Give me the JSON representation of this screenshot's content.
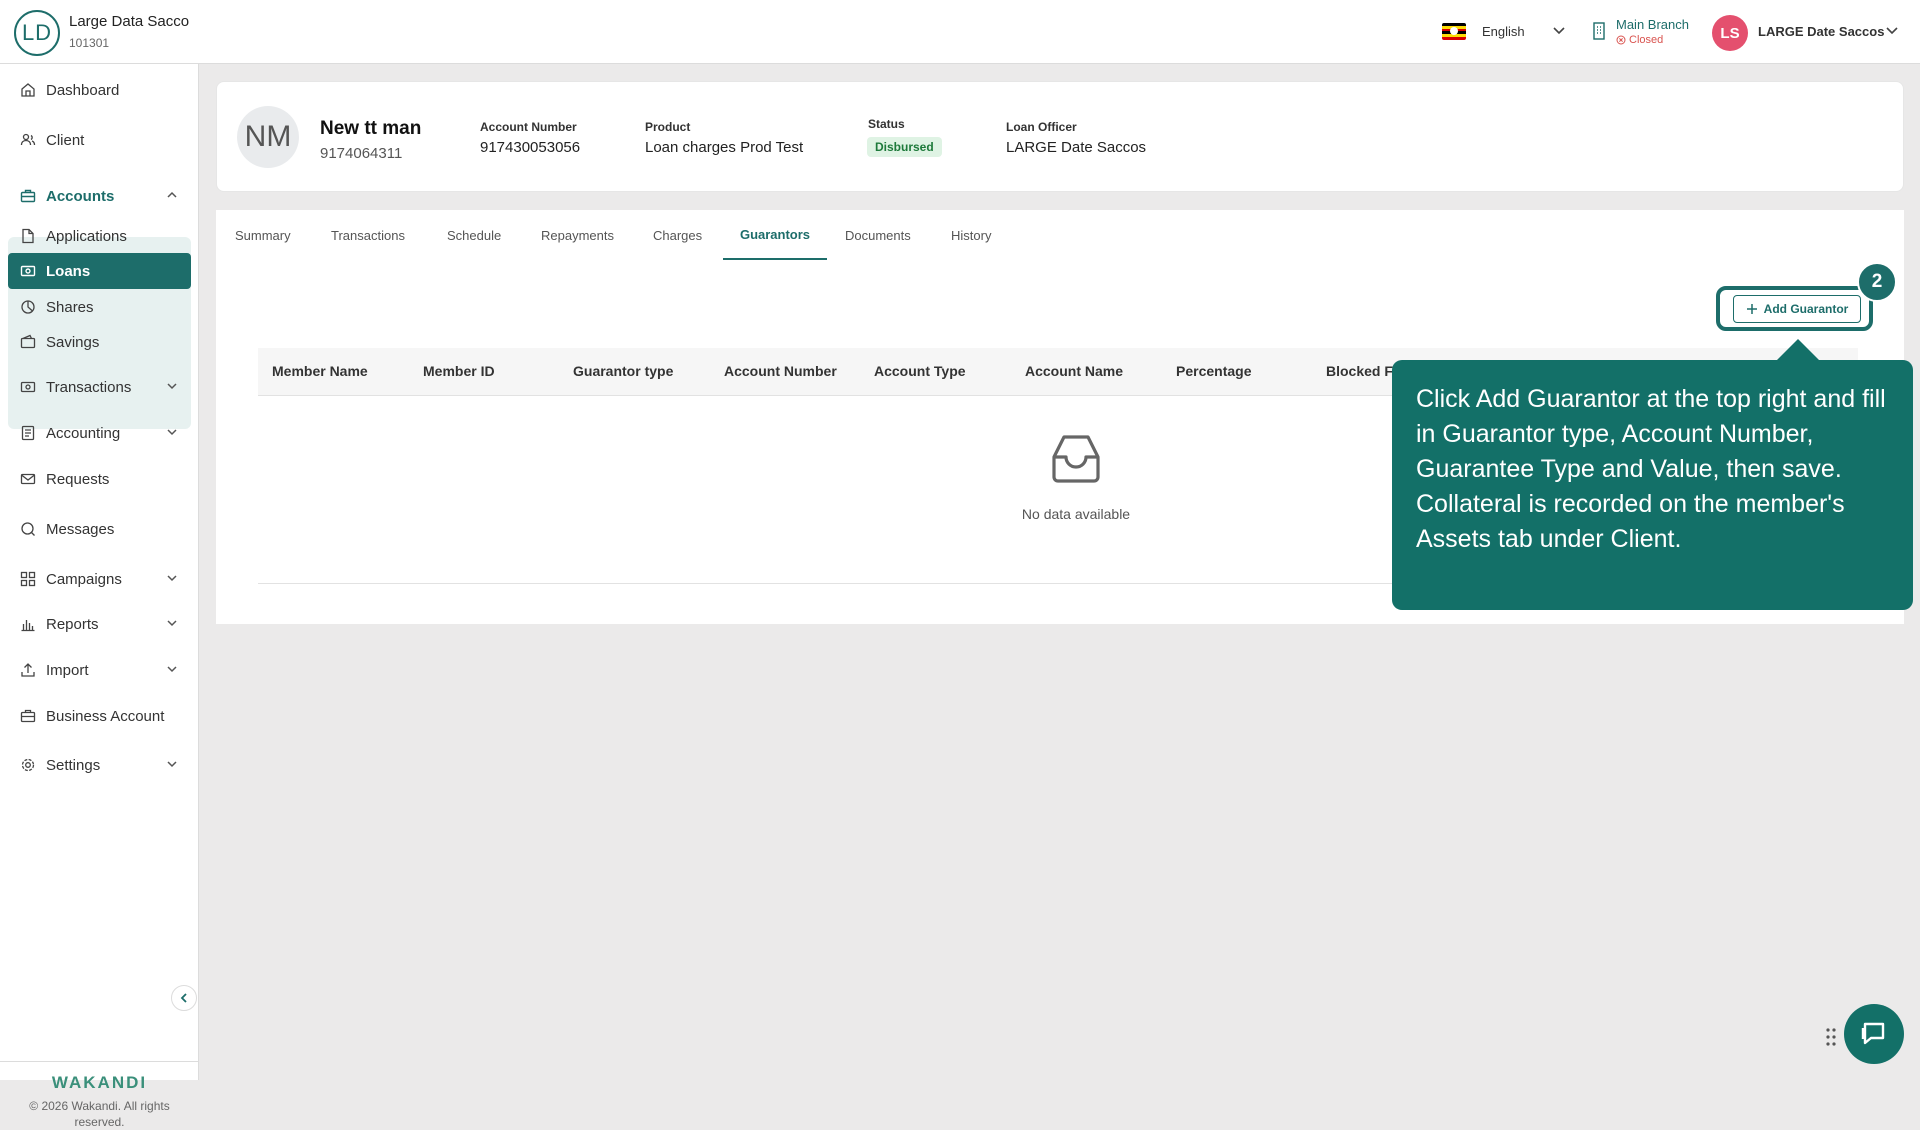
{
  "topbar": {
    "org_initials": "LD",
    "org_name": "Large Data Sacco",
    "org_id": "101301",
    "language": "English",
    "branch_name": "Main Branch",
    "branch_status": "Closed",
    "user_initials": "LS",
    "user_name": "LARGE Date Saccos"
  },
  "sidebar": {
    "items": [
      {
        "label": "Dashboard",
        "icon": "home-icon"
      },
      {
        "label": "Client",
        "icon": "users-icon"
      },
      {
        "label": "Accounts",
        "icon": "briefcase-icon"
      },
      {
        "label": "Applications",
        "icon": "file-icon"
      },
      {
        "label": "Loans",
        "icon": "cash-icon"
      },
      {
        "label": "Shares",
        "icon": "pie-icon"
      },
      {
        "label": "Savings",
        "icon": "wallet-icon"
      },
      {
        "label": "Transactions",
        "icon": "cash-icon"
      },
      {
        "label": "Accounting",
        "icon": "ledger-icon"
      },
      {
        "label": "Requests",
        "icon": "mail-icon"
      },
      {
        "label": "Messages",
        "icon": "chat-icon"
      },
      {
        "label": "Campaigns",
        "icon": "grid-icon"
      },
      {
        "label": "Reports",
        "icon": "bar-chart-icon"
      },
      {
        "label": "Import",
        "icon": "upload-icon"
      },
      {
        "label": "Business Account",
        "icon": "briefcase-icon"
      },
      {
        "label": "Settings",
        "icon": "gear-icon"
      }
    ],
    "brand": "WAKANDI",
    "copyright": "© 2026 Wakandi. All rights reserved."
  },
  "header": {
    "client_initials": "NM",
    "client_name": "New tt man",
    "client_id": "9174064311",
    "account_number_label": "Account Number",
    "account_number": "917430053056",
    "product_label": "Product",
    "product": "Loan charges Prod Test",
    "status_label": "Status",
    "status": "Disbursed",
    "loan_officer_label": "Loan Officer",
    "loan_officer": "LARGE Date Saccos"
  },
  "tabs": [
    {
      "label": "Summary"
    },
    {
      "label": "Transactions"
    },
    {
      "label": "Schedule"
    },
    {
      "label": "Repayments"
    },
    {
      "label": "Charges"
    },
    {
      "label": "Guarantors"
    },
    {
      "label": "Documents"
    },
    {
      "label": "History"
    }
  ],
  "active_tab": "Guarantors",
  "guarantors": {
    "add_button": "Add Guarantor",
    "columns": [
      "Member Name",
      "Member ID",
      "Guarantor type",
      "Account Number",
      "Account Type",
      "Account Name",
      "Percentage",
      "Blocked Fu"
    ],
    "empty_text": "No data available"
  },
  "guide": {
    "step": "2",
    "text": "Click Add Guarantor at the top right and fill in Guarantor type, Account Number, Guarantee Type and Value, then save. Collateral is recorded on the member's Assets tab under Client."
  },
  "colors": {
    "primary": "#1d6d6a",
    "tooltip": "#137068",
    "status_bg": "#dff3e4",
    "status_text": "#1e7a3b",
    "user_avatar": "#e4506e"
  }
}
